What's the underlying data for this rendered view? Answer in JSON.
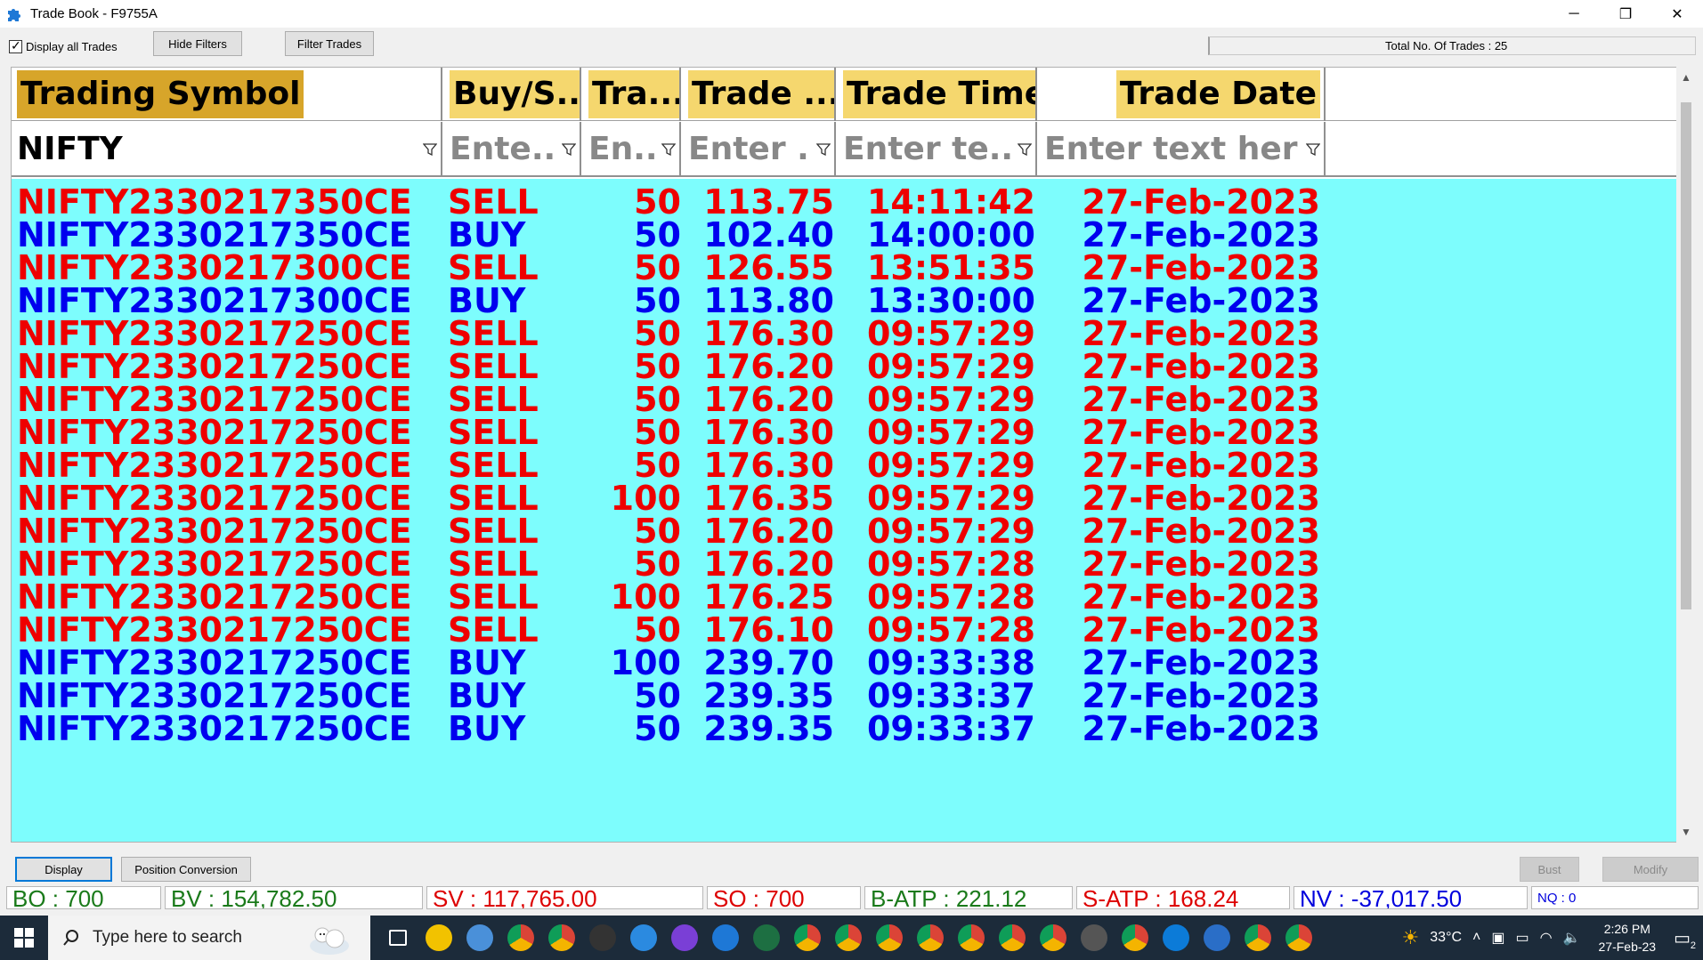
{
  "window": {
    "title": "Trade Book - F9755A",
    "minimize_glyph": "─",
    "maximize_glyph": "❐",
    "close_glyph": "✕"
  },
  "toolbar": {
    "display_all_label": "Display all Trades",
    "display_all_checked": true,
    "hide_filters_label": "Hide Filters",
    "filter_trades_label": "Filter Trades",
    "total_trades_text": "Total No. Of Trades : 25"
  },
  "grid": {
    "columns": [
      {
        "label": "Trading Symbol",
        "filter_value": "NIFTY",
        "filter_placeholder": ""
      },
      {
        "label": "Buy/S...",
        "filter_value": "",
        "filter_placeholder": "Ente..."
      },
      {
        "label": "Tra...",
        "filter_value": "",
        "filter_placeholder": "En..."
      },
      {
        "label": "Trade ...",
        "filter_value": "",
        "filter_placeholder": "Enter ..."
      },
      {
        "label": "Trade Time",
        "filter_value": "",
        "filter_placeholder": "Enter te..."
      },
      {
        "label": "Trade Date",
        "filter_value": "",
        "filter_placeholder": "Enter text here"
      }
    ],
    "rows": [
      {
        "symbol": "NIFTY2330217350CE",
        "side": "SELL",
        "qty": "50",
        "price": "113.75",
        "time": "14:11:42",
        "date": "27-Feb-2023"
      },
      {
        "symbol": "NIFTY2330217350CE",
        "side": "BUY",
        "qty": "50",
        "price": "102.40",
        "time": "14:00:00",
        "date": "27-Feb-2023"
      },
      {
        "symbol": "NIFTY2330217300CE",
        "side": "SELL",
        "qty": "50",
        "price": "126.55",
        "time": "13:51:35",
        "date": "27-Feb-2023"
      },
      {
        "symbol": "NIFTY2330217300CE",
        "side": "BUY",
        "qty": "50",
        "price": "113.80",
        "time": "13:30:00",
        "date": "27-Feb-2023"
      },
      {
        "symbol": "NIFTY2330217250CE",
        "side": "SELL",
        "qty": "50",
        "price": "176.30",
        "time": "09:57:29",
        "date": "27-Feb-2023"
      },
      {
        "symbol": "NIFTY2330217250CE",
        "side": "SELL",
        "qty": "50",
        "price": "176.20",
        "time": "09:57:29",
        "date": "27-Feb-2023"
      },
      {
        "symbol": "NIFTY2330217250CE",
        "side": "SELL",
        "qty": "50",
        "price": "176.20",
        "time": "09:57:29",
        "date": "27-Feb-2023"
      },
      {
        "symbol": "NIFTY2330217250CE",
        "side": "SELL",
        "qty": "50",
        "price": "176.30",
        "time": "09:57:29",
        "date": "27-Feb-2023"
      },
      {
        "symbol": "NIFTY2330217250CE",
        "side": "SELL",
        "qty": "50",
        "price": "176.30",
        "time": "09:57:29",
        "date": "27-Feb-2023"
      },
      {
        "symbol": "NIFTY2330217250CE",
        "side": "SELL",
        "qty": "100",
        "price": "176.35",
        "time": "09:57:29",
        "date": "27-Feb-2023"
      },
      {
        "symbol": "NIFTY2330217250CE",
        "side": "SELL",
        "qty": "50",
        "price": "176.20",
        "time": "09:57:29",
        "date": "27-Feb-2023"
      },
      {
        "symbol": "NIFTY2330217250CE",
        "side": "SELL",
        "qty": "50",
        "price": "176.20",
        "time": "09:57:28",
        "date": "27-Feb-2023"
      },
      {
        "symbol": "NIFTY2330217250CE",
        "side": "SELL",
        "qty": "100",
        "price": "176.25",
        "time": "09:57:28",
        "date": "27-Feb-2023"
      },
      {
        "symbol": "NIFTY2330217250CE",
        "side": "SELL",
        "qty": "50",
        "price": "176.10",
        "time": "09:57:28",
        "date": "27-Feb-2023"
      },
      {
        "symbol": "NIFTY2330217250CE",
        "side": "BUY",
        "qty": "100",
        "price": "239.70",
        "time": "09:33:38",
        "date": "27-Feb-2023"
      },
      {
        "symbol": "NIFTY2330217250CE",
        "side": "BUY",
        "qty": "50",
        "price": "239.35",
        "time": "09:33:37",
        "date": "27-Feb-2023"
      },
      {
        "symbol": "NIFTY2330217250CE",
        "side": "BUY",
        "qty": "50",
        "price": "239.35",
        "time": "09:33:37",
        "date": "27-Feb-2023"
      }
    ]
  },
  "bottom_buttons": {
    "display_label": "Display",
    "position_conversion_label": "Position Conversion",
    "bust_label": "Bust",
    "modify_label": "Modify"
  },
  "status_bar": {
    "bo": "BO : 700",
    "bv": "BV : 154,782.50",
    "sv": "SV : 117,765.00",
    "so": "SO : 700",
    "b_atp": "B-ATP : 221.12",
    "s_atp": "S-ATP : 168.24",
    "nv": "NV : -37,017.50",
    "nq": "NQ : 0"
  },
  "colors": {
    "sell": "#ee0000",
    "buy": "#0000ee",
    "grid_bg": "#7dfdfd",
    "header_label_bg": "#f5d76e"
  },
  "taskbar": {
    "search_placeholder": "Type here to search",
    "weather": "33°C",
    "time": "2:26 PM",
    "date": "27-Feb-23",
    "notification_count": "2",
    "pinned_icons": [
      "task-view-icon",
      "file-explorer-icon",
      "network-icon",
      "chrome-icon",
      "chrome-icon",
      "trading-app-icon",
      "snip-icon",
      "affinity-icon",
      "app-icon",
      "excel-icon",
      "chrome-icon",
      "chrome-icon",
      "chrome-icon",
      "chrome-icon",
      "chrome-icon",
      "chrome-icon",
      "chrome-icon",
      "calculator-icon",
      "chrome-icon",
      "edge-icon",
      "photos-icon",
      "chrome-icon",
      "chrome-icon"
    ]
  }
}
